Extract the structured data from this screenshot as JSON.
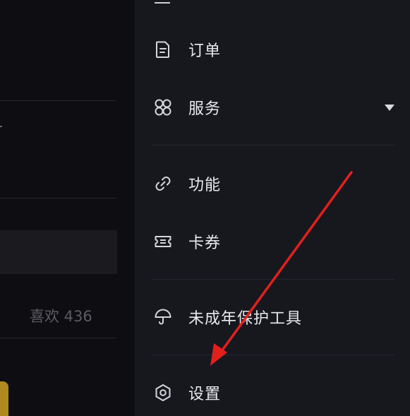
{
  "background": {
    "likes_text": "喜欢 436"
  },
  "drawer": {
    "items": [
      {
        "id": "orders",
        "label": "订单",
        "icon": "document-icon"
      },
      {
        "id": "services",
        "label": "服务",
        "icon": "grid-icon",
        "expandable": true
      },
      {
        "id": "features",
        "label": "功能",
        "icon": "link-icon"
      },
      {
        "id": "coupons",
        "label": "卡券",
        "icon": "ticket-icon"
      },
      {
        "id": "minor-protection",
        "label": "未成年保护工具",
        "icon": "umbrella-icon"
      },
      {
        "id": "settings",
        "label": "设置",
        "icon": "gear-icon"
      }
    ]
  },
  "annotation": {
    "type": "arrow",
    "color": "#e0201d",
    "points_to": "settings"
  },
  "colors": {
    "drawer_bg": "#17171e",
    "page_bg": "#0e0e12",
    "text": "#e9e9ee",
    "arrow": "#e0201d"
  }
}
